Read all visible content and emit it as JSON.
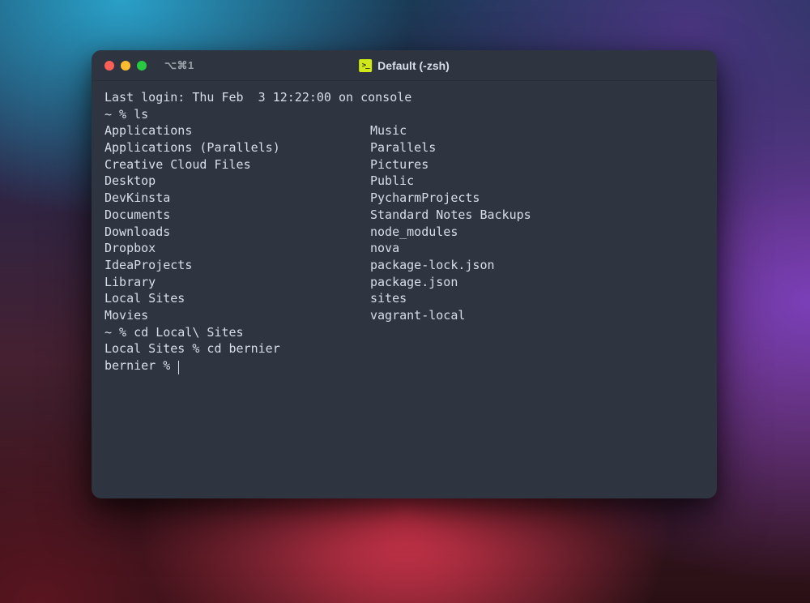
{
  "titlebar": {
    "tab_hint": "⌥⌘1",
    "title": "Default (-zsh)"
  },
  "session": {
    "last_login": "Last login: Thu Feb  3 12:22:00 on console",
    "prompt1": "~ % ls",
    "ls_left": [
      "Applications",
      "Applications (Parallels)",
      "Creative Cloud Files",
      "Desktop",
      "DevKinsta",
      "Documents",
      "Downloads",
      "Dropbox",
      "IdeaProjects",
      "Library",
      "Local Sites",
      "Movies"
    ],
    "ls_right": [
      "Music",
      "Parallels",
      "Pictures",
      "Public",
      "PycharmProjects",
      "Standard Notes Backups",
      "node_modules",
      "nova",
      "package-lock.json",
      "package.json",
      "sites",
      "vagrant-local"
    ],
    "prompt2": "~ % cd Local\\ Sites",
    "prompt3": "Local Sites % cd bernier",
    "prompt4": "bernier % "
  }
}
